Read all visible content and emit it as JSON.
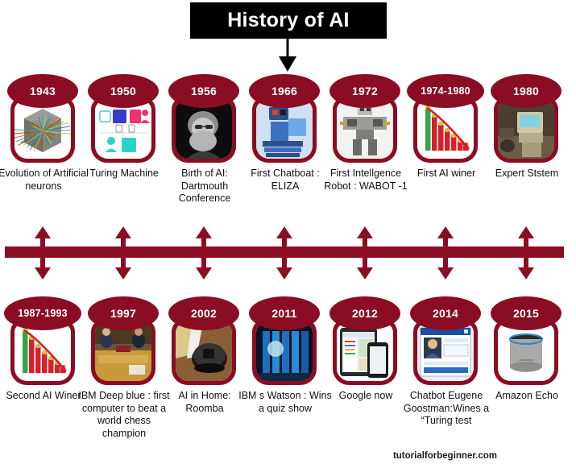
{
  "header": {
    "title": "History of AI",
    "arrow_icon": "down-arrow-icon"
  },
  "footer": {
    "credit": "tutorialforbeginner.com"
  },
  "colors": {
    "brand_crimson": "#8B0D23",
    "title_background": "#000000",
    "title_text": "#ffffff",
    "caption_text": "#111111"
  },
  "timeline": {
    "spine_color": "#8B0D23",
    "tick_count": 7,
    "tick_icon": "double-arrow-vertical-icon"
  },
  "top_row": [
    {
      "year": "1943",
      "caption": "Evolution of Artificial neurons",
      "image": "neural-cube-image"
    },
    {
      "year": "1950",
      "caption": "Turing Machine",
      "image": "turing-test-diagram-image"
    },
    {
      "year": "1956",
      "caption": "Birth of AI: Dartmouth Conference",
      "image": "dartmouth-portrait-image"
    },
    {
      "year": "1966",
      "caption": "First Chatboat : ELIZA",
      "image": "eliza-robot-image"
    },
    {
      "year": "1972",
      "caption": "First Intellgence Robot : WABOT -1",
      "image": "wabot-robot-image"
    },
    {
      "year": "1974-1980",
      "caption": "First AI winer",
      "image": "declining-bar-chart-image"
    },
    {
      "year": "1980",
      "caption": "Expert Ststem",
      "image": "vintage-computer-image"
    }
  ],
  "bottom_row": [
    {
      "year": "1987-1993",
      "caption": "Second AI Winer",
      "image": "declining-bar-chart-image"
    },
    {
      "year": "1997",
      "caption": "IBM Deep blue : first computer to beat a world chess champion",
      "image": "chess-match-image"
    },
    {
      "year": "2002",
      "caption": "AI in Home: Roomba",
      "image": "roomba-vacuum-image"
    },
    {
      "year": "2011",
      "caption": "IBM s Watson : Wins a quiz show",
      "image": "watson-servers-image"
    },
    {
      "year": "2012",
      "caption": "Google now",
      "image": "google-now-devices-image"
    },
    {
      "year": "2014",
      "caption": "Chatbot Eugene Goostman:Wines a “Turing test",
      "image": "eugene-goostman-chat-image"
    },
    {
      "year": "2015",
      "caption": "Amazon Echo",
      "image": "amazon-echo-image"
    }
  ]
}
